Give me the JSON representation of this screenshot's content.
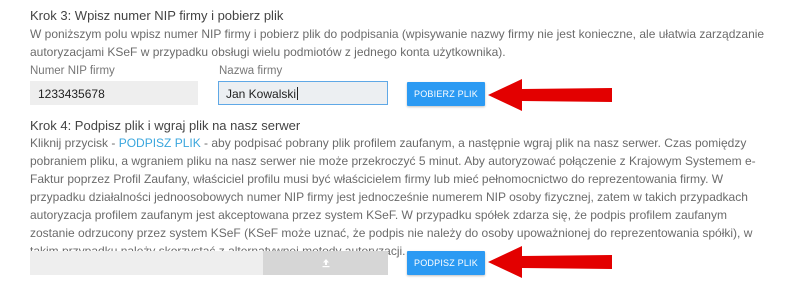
{
  "step3": {
    "title": "Krok 3: Wpisz numer NIP firmy i pobierz plik",
    "description": "W poniższym polu wpisz numer NIP firmy i pobierz plik do podpisania (wpisywanie nazwy firmy nie jest konieczne, ale ułatwia zarządzanie autoryzacjami KSeF w przypadku obsługi wielu podmiotów z jednego konta użytkownika).",
    "nip_label": "Numer NIP firmy",
    "nip_value": "1233435678",
    "company_label": "Nazwa firmy",
    "company_value": "Jan Kowalski",
    "download_button": "POBIERZ PLIK"
  },
  "step4": {
    "title": "Krok 4: Podpisz plik i wgraj plik na nasz serwer",
    "description_prefix": "Kliknij przycisk - ",
    "description_link": "PODPISZ PLIK",
    "description_rest": " - aby podpisać pobrany plik profilem zaufanym, a następnie wgraj plik na nasz serwer. Czas pomiędzy pobraniem pliku, a wgraniem pliku na nasz serwer nie może przekroczyć 5 minut. Aby autoryzować połączenie z Krajowym Systemem e-Faktur poprzez Profil Zaufany, właściciel profilu musi być właścicielem firmy lub mieć pełnomocnictwo do reprezentowania firmy. W przypadku działalności jednoosobowych numer NIP firmy jest jednocześnie numerem NIP osoby fizycznej, zatem w takich przypadkach autoryzacja profilem zaufanym jest akceptowana przez system KSeF. W przypadku spółek zdarza się, że podpis profilem zaufanym zostanie odrzucony przez system KSeF (KSeF może uznać, że podpis nie należy do osoby upoważnionej do reprezentowania spółki), w takim przypadku należy skorzystać z alternatywnej metody autoryzacji.",
    "sign_button": "PODPISZ PLIK",
    "upload_icon": "upload-icon"
  },
  "colors": {
    "primary_button": "#2b9af3",
    "link": "#3aa6dd",
    "arrow": "#e30000"
  }
}
